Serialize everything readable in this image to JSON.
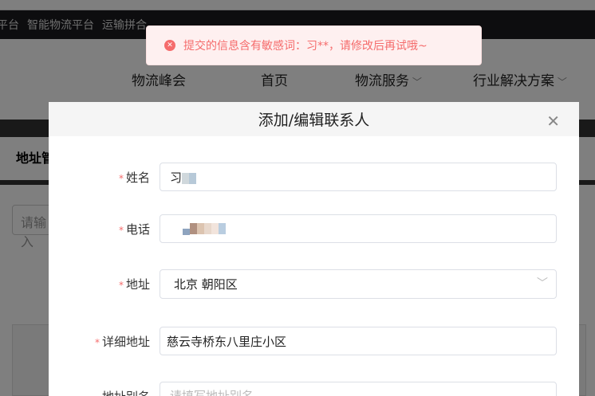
{
  "topnav": {
    "items": [
      "平台",
      "智能物流平台",
      "运输拼合"
    ]
  },
  "menu": {
    "items": [
      "物流峰会",
      "首页",
      "物流服务",
      "行业解决方案"
    ]
  },
  "page": {
    "tab_label": "地址管",
    "search_placeholder": "请输入"
  },
  "toast": {
    "message": "提交的信息含有敏感词：习**，请修改后再试哦~",
    "type": "error",
    "color": "#f56c6c"
  },
  "modal": {
    "title": "添加/编辑联系人",
    "fields": [
      {
        "label": "姓名",
        "required": true,
        "value": "习"
      },
      {
        "label": "电话",
        "required": true,
        "value": ""
      },
      {
        "label": "地址",
        "required": true,
        "value": "北京 朝阳区"
      },
      {
        "label": "详细地址",
        "required": true,
        "value": "慈云寺桥东八里庄小区"
      },
      {
        "label": "地址别名",
        "required": false,
        "placeholder": "请填写地址别名"
      }
    ]
  }
}
